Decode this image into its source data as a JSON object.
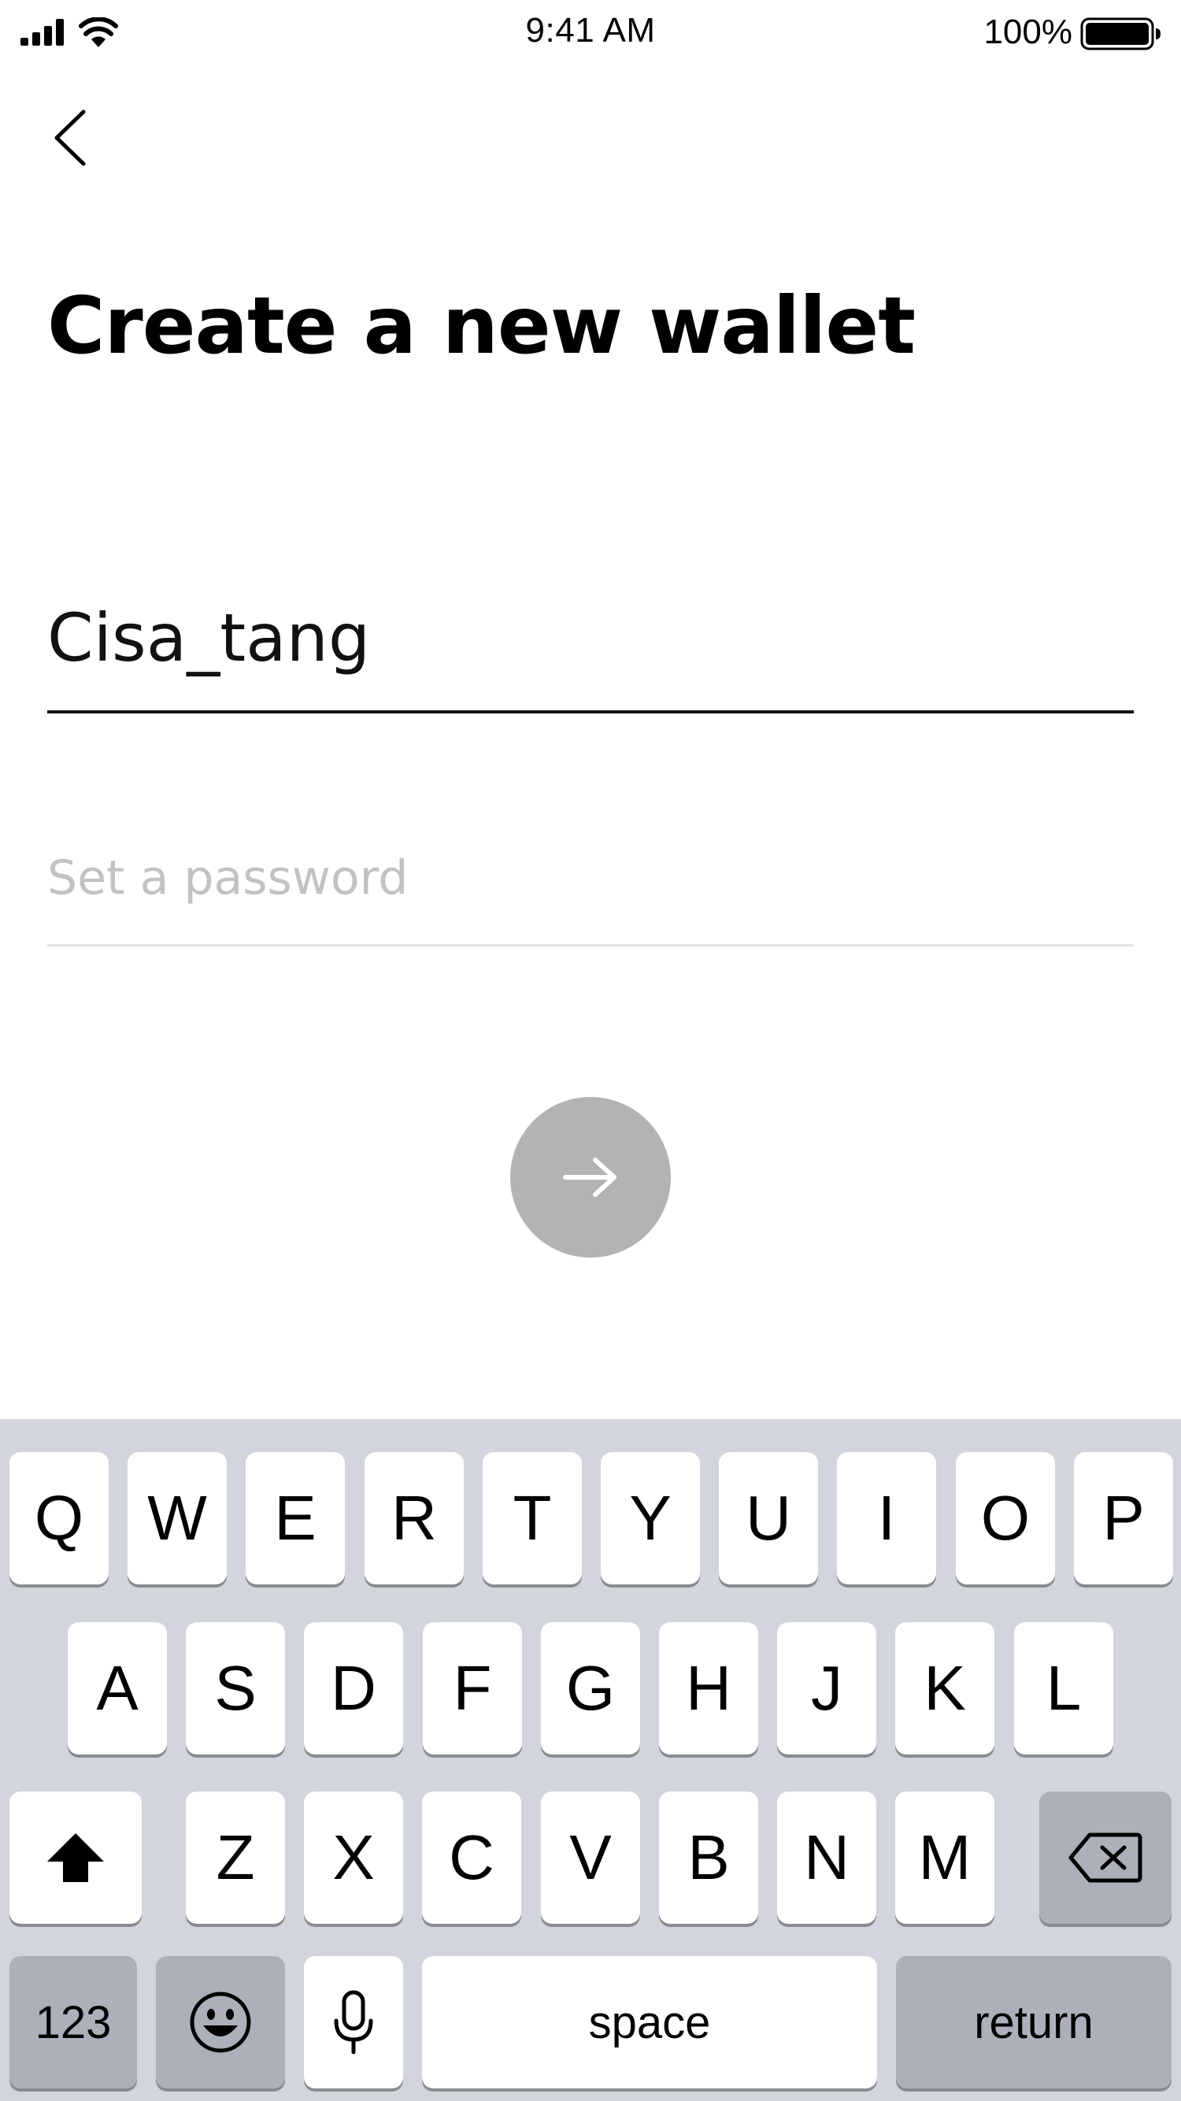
{
  "status_bar": {
    "time": "9:41 AM",
    "battery_percent": "100%",
    "battery_level": 1.0,
    "signal_icon": "cellular-signal-icon",
    "wifi_icon": "wifi-icon",
    "battery_icon": "battery-icon"
  },
  "nav": {
    "back_icon": "chevron-left-icon"
  },
  "page": {
    "title": "Create a new wallet"
  },
  "form": {
    "wallet_name": {
      "value": "Cisa_tang",
      "placeholder": ""
    },
    "password": {
      "value": "",
      "placeholder": "Set a password"
    },
    "next_button_icon": "arrow-right-icon",
    "next_button_color": "#b3b3b3"
  },
  "keyboard": {
    "row1": [
      "Q",
      "W",
      "E",
      "R",
      "T",
      "Y",
      "U",
      "I",
      "O",
      "P"
    ],
    "row2": [
      "A",
      "S",
      "D",
      "F",
      "G",
      "H",
      "J",
      "K",
      "L"
    ],
    "row3": [
      "Z",
      "X",
      "C",
      "V",
      "B",
      "N",
      "M"
    ],
    "shift_icon": "shift-arrow-icon",
    "delete_icon": "backspace-icon",
    "numbers_label": "123",
    "emoji_icon": "emoji-icon",
    "mic_icon": "microphone-icon",
    "space_label": "space",
    "return_label": "return",
    "background_color": "#d2d5db"
  }
}
